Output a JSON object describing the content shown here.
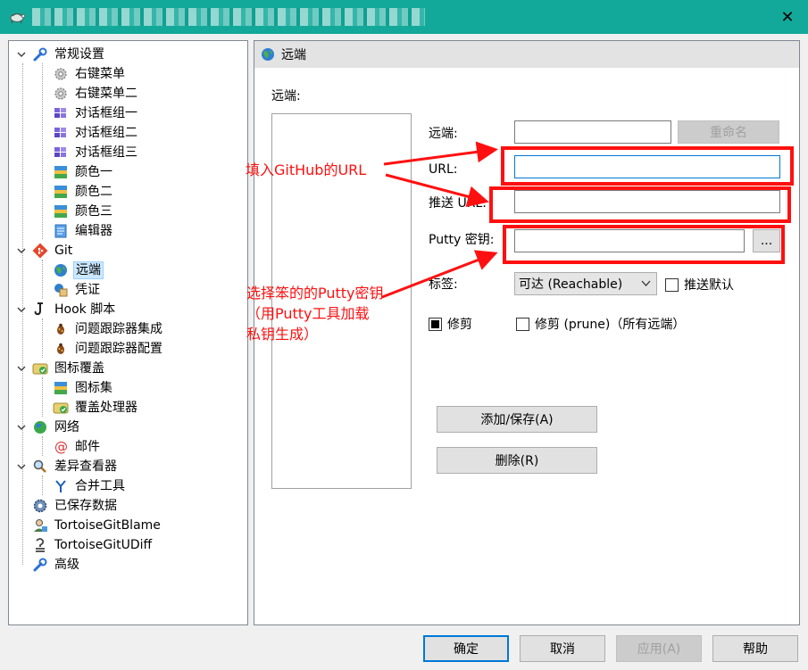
{
  "titlebar": {
    "title": "▒▒▒▒ ▒▒▒▒ ▒▒▒▒ ▒▒▒▒▒▒ ▒▒ ▒▒▒▒",
    "close": "✕"
  },
  "tree": {
    "items": [
      {
        "label": "常规设置",
        "icon": "wrench-icon"
      },
      {
        "label": "右键菜单",
        "icon": "gear-icon"
      },
      {
        "label": "右键菜单二",
        "icon": "gear-icon"
      },
      {
        "label": "对话框组一",
        "icon": "windows-icon"
      },
      {
        "label": "对话框组二",
        "icon": "windows-icon"
      },
      {
        "label": "对话框组三",
        "icon": "windows-icon"
      },
      {
        "label": "颜色一",
        "icon": "palette-icon"
      },
      {
        "label": "颜色二",
        "icon": "palette-icon"
      },
      {
        "label": "颜色三",
        "icon": "palette-icon"
      },
      {
        "label": "编辑器",
        "icon": "editor-icon"
      },
      {
        "label": "Git",
        "icon": "git-icon"
      },
      {
        "label": "远端",
        "icon": "globe-icon"
      },
      {
        "label": "凭证",
        "icon": "credential-icon"
      },
      {
        "label": "Hook 脚本",
        "icon": "hook-icon"
      },
      {
        "label": "问题跟踪器集成",
        "icon": "bug-icon"
      },
      {
        "label": "问题跟踪器配置",
        "icon": "bug-icon"
      },
      {
        "label": "图标覆盖",
        "icon": "overlay-icon"
      },
      {
        "label": "图标集",
        "icon": "palette-icon"
      },
      {
        "label": "覆盖处理器",
        "icon": "overlay-icon"
      },
      {
        "label": "网络",
        "icon": "network-globe-icon"
      },
      {
        "label": "邮件",
        "icon": "at-icon"
      },
      {
        "label": "差异查看器",
        "icon": "magnifier-icon"
      },
      {
        "label": "合并工具",
        "icon": "merge-icon"
      },
      {
        "label": "已保存数据",
        "icon": "gear-blue-icon"
      },
      {
        "label": "TortoiseGitBlame",
        "icon": "blame-icon"
      },
      {
        "label": "TortoiseGitUDiff",
        "icon": "udiff-icon"
      },
      {
        "label": "高级",
        "icon": "wrench-icon"
      }
    ]
  },
  "panel": {
    "header": "远端",
    "remote_list_label": "远端:",
    "remote_label": "远端:",
    "remote_value": "",
    "rename_button": "重命名",
    "url_label": "URL:",
    "url_value": "",
    "push_url_label": "推送 URL:",
    "push_url_value": "",
    "putty_label": "Putty 密钥:",
    "putty_value": "",
    "browse_button": "...",
    "tag_label": "标签:",
    "tag_selected": "可达 (Reachable)",
    "push_default_label": "推送默认",
    "prune_label": "修剪",
    "prune_all_label": "修剪 (prune)（所有远端）",
    "add_save_button": "添加/保存(A)",
    "delete_button": "删除(R)"
  },
  "footer": {
    "ok": "确定",
    "cancel": "取消",
    "apply": "应用(A)",
    "help": "帮助"
  },
  "annotations": {
    "fill_url": "填入GitHub的URL",
    "putty_line1": "选择笨的的Putty密钥",
    "putty_line2": "（用Putty工具加载",
    "putty_line3": "私钥生成）",
    "color": "#ff1010"
  }
}
